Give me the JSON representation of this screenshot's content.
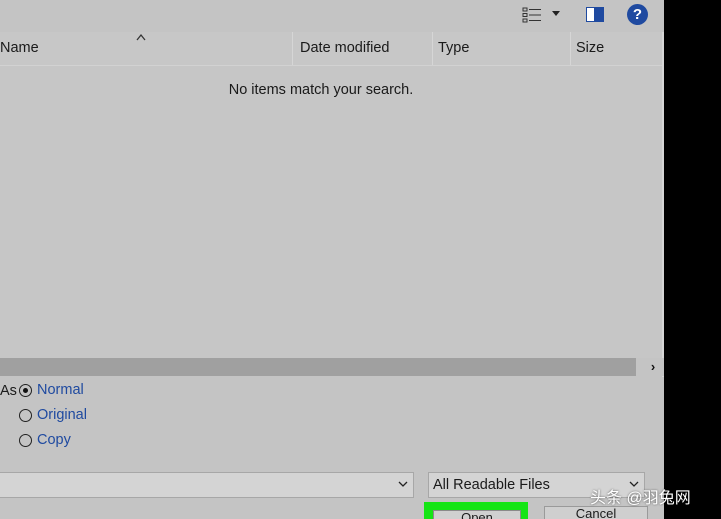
{
  "columns": {
    "name": "Name",
    "date_modified": "Date modified",
    "type": "Type",
    "size": "Size"
  },
  "list": {
    "empty_message": "No items match your search."
  },
  "open_as": {
    "label": "As",
    "options": [
      {
        "label": "Normal",
        "selected": true
      },
      {
        "label": "Original",
        "selected": false
      },
      {
        "label": "Copy",
        "selected": false
      }
    ]
  },
  "filename": {
    "value": ""
  },
  "filetype": {
    "selected": "All Readable Files"
  },
  "buttons": {
    "open_label": "Open",
    "cancel_label": "Cancel"
  },
  "help": {
    "glyph": "?"
  },
  "watermark": {
    "text": "头条 @羽兔网"
  },
  "icons": {
    "view": "view-options-icon",
    "preview_pane": "preview-pane-icon",
    "help": "help-icon"
  },
  "colors": {
    "accent": "#1f4aa0",
    "highlight": "#15e515",
    "dialog_bg": "#c4c4c4"
  }
}
